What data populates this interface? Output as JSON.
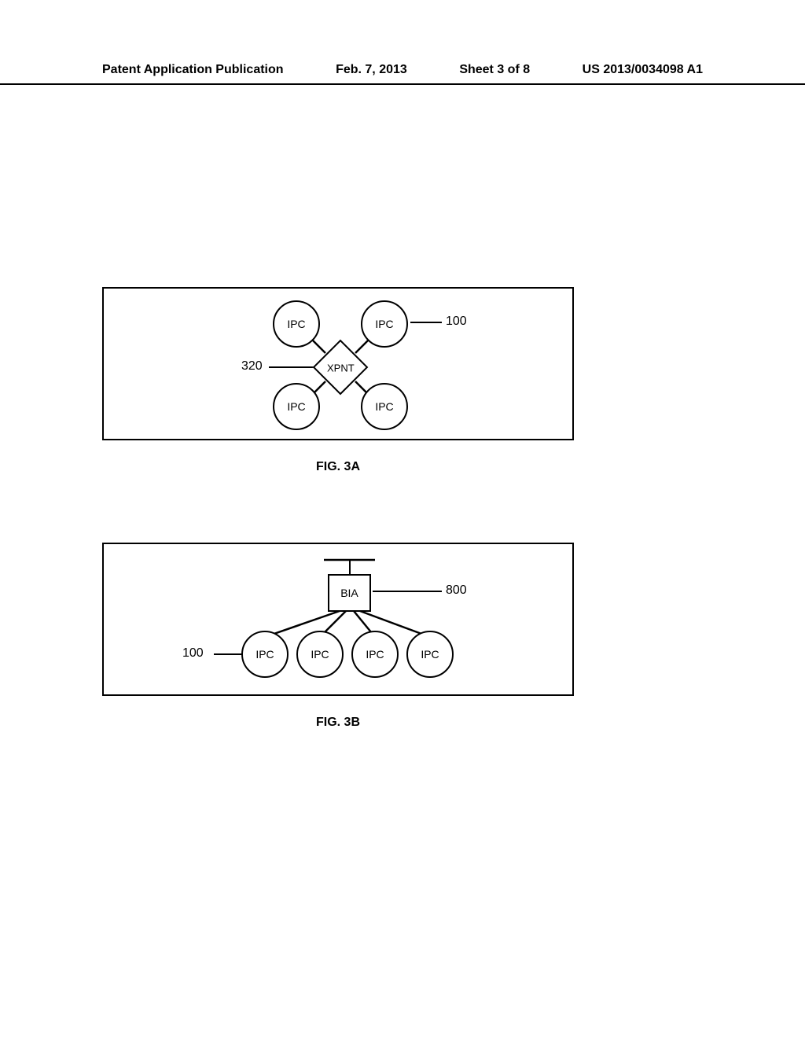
{
  "header": {
    "pubType": "Patent Application Publication",
    "date": "Feb. 7, 2013",
    "sheet": "Sheet 3 of 8",
    "pubNumber": "US 2013/0034098 A1"
  },
  "fig3a": {
    "caption": "FIG. 3A",
    "ipc_label": "IPC",
    "xpnt_label": "XPNT",
    "ref_320": "320",
    "ref_100": "100"
  },
  "fig3b": {
    "caption": "FIG. 3B",
    "ipc_label": "IPC",
    "bia_label": "BIA",
    "ref_100": "100",
    "ref_800": "800"
  }
}
